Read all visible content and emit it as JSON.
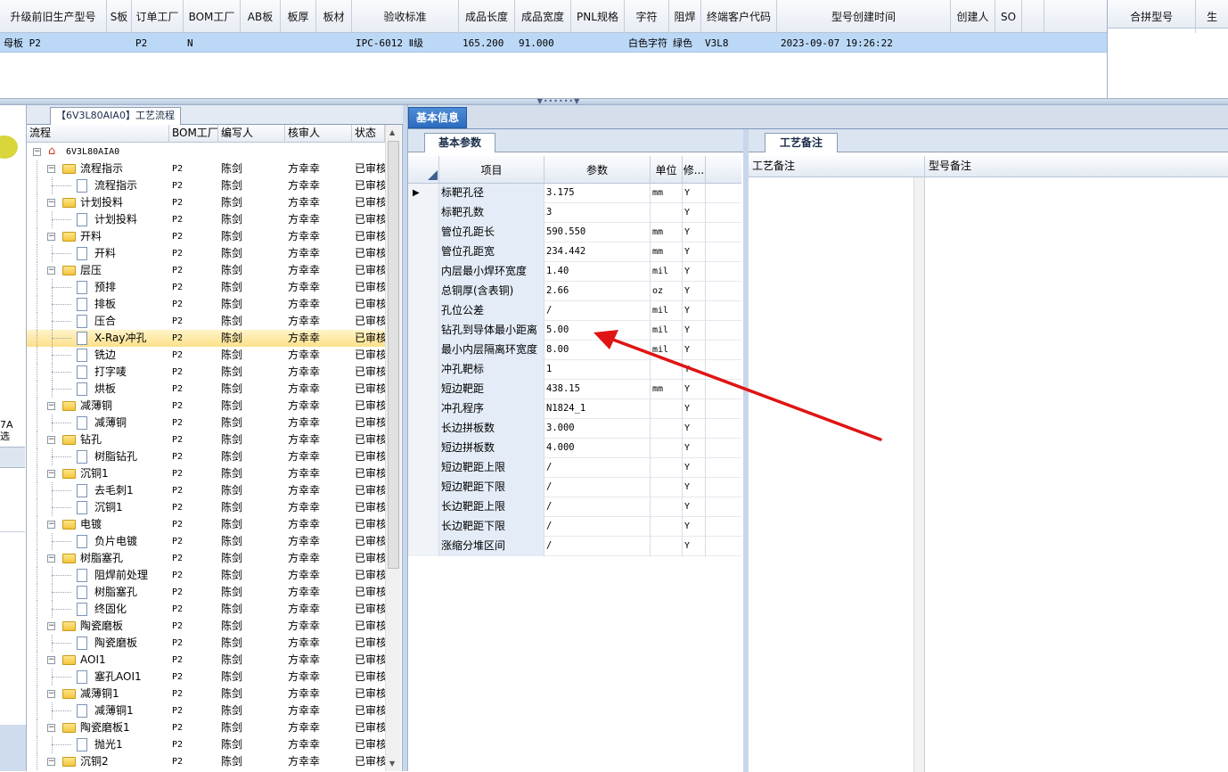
{
  "top_grid": {
    "columns": [
      {
        "label": "升级前旧生产型号",
        "w": 120
      },
      {
        "label": "S板",
        "w": 28
      },
      {
        "label": "订单工厂",
        "w": 58
      },
      {
        "label": "BOM工厂",
        "w": 64
      },
      {
        "label": "AB板",
        "w": 45
      },
      {
        "label": "板厚",
        "w": 40
      },
      {
        "label": "板材",
        "w": 40
      },
      {
        "label": "验收标准",
        "w": 120
      },
      {
        "label": "成品长度",
        "w": 63
      },
      {
        "label": "成品宽度",
        "w": 63
      },
      {
        "label": "PNL规格",
        "w": 60
      },
      {
        "label": "字符",
        "w": 50
      },
      {
        "label": "阻焊",
        "w": 36
      },
      {
        "label": "终端客户代码",
        "w": 85
      },
      {
        "label": "型号创建时间",
        "w": 195
      },
      {
        "label": "创建人",
        "w": 50
      },
      {
        "label": "SO",
        "w": 30
      },
      {
        "label": "",
        "w": 25
      }
    ],
    "row": [
      "母板  P2",
      "",
      "P2",
      "N",
      "",
      "",
      "",
      "IPC-6012 Ⅱ级",
      "165.200",
      "91.000",
      "",
      "白色字符",
      "绿色",
      "V3L8",
      "2023-09-07 19:26:22",
      "",
      "",
      ""
    ]
  },
  "merge_panel": {
    "col1": "合拼型号",
    "col2": "生"
  },
  "left_strip": {
    "label1": "7A",
    "label2": "选"
  },
  "process_panel": {
    "tab_title": "【6V3L80AIA0】工艺流程",
    "headers": [
      "流程",
      "BOM工厂",
      "编写人",
      "核审人",
      "状态"
    ],
    "root": "6V3L80AIA0",
    "rows": [
      {
        "lvl": 1,
        "name": "流程指示",
        "bom": "P2",
        "writer": "陈剑",
        "checker": "方幸幸",
        "status": "已审核"
      },
      {
        "lvl": 2,
        "name": "流程指示",
        "bom": "P2",
        "writer": "陈剑",
        "checker": "方幸幸",
        "status": "已审核"
      },
      {
        "lvl": 1,
        "name": "计划投料",
        "bom": "P2",
        "writer": "陈剑",
        "checker": "方幸幸",
        "status": "已审核"
      },
      {
        "lvl": 2,
        "name": "计划投料",
        "bom": "P2",
        "writer": "陈剑",
        "checker": "方幸幸",
        "status": "已审核"
      },
      {
        "lvl": 1,
        "name": "开料",
        "bom": "P2",
        "writer": "陈剑",
        "checker": "方幸幸",
        "status": "已审核"
      },
      {
        "lvl": 2,
        "name": "开料",
        "bom": "P2",
        "writer": "陈剑",
        "checker": "方幸幸",
        "status": "已审核"
      },
      {
        "lvl": 1,
        "name": "层压",
        "bom": "P2",
        "writer": "陈剑",
        "checker": "方幸幸",
        "status": "已审核"
      },
      {
        "lvl": 2,
        "name": "预排",
        "bom": "P2",
        "writer": "陈剑",
        "checker": "方幸幸",
        "status": "已审核"
      },
      {
        "lvl": 2,
        "name": "排板",
        "bom": "P2",
        "writer": "陈剑",
        "checker": "方幸幸",
        "status": "已审核"
      },
      {
        "lvl": 2,
        "name": "压合",
        "bom": "P2",
        "writer": "陈剑",
        "checker": "方幸幸",
        "status": "已审核"
      },
      {
        "lvl": 2,
        "name": "X-Ray冲孔",
        "bom": "P2",
        "writer": "陈剑",
        "checker": "方幸幸",
        "status": "已审核",
        "sel": true
      },
      {
        "lvl": 2,
        "name": "铣边",
        "bom": "P2",
        "writer": "陈剑",
        "checker": "方幸幸",
        "status": "已审核"
      },
      {
        "lvl": 2,
        "name": "打字唛",
        "bom": "P2",
        "writer": "陈剑",
        "checker": "方幸幸",
        "status": "已审核"
      },
      {
        "lvl": 2,
        "name": "烘板",
        "bom": "P2",
        "writer": "陈剑",
        "checker": "方幸幸",
        "status": "已审核"
      },
      {
        "lvl": 1,
        "name": "减薄铜",
        "bom": "P2",
        "writer": "陈剑",
        "checker": "方幸幸",
        "status": "已审核"
      },
      {
        "lvl": 2,
        "name": "减薄铜",
        "bom": "P2",
        "writer": "陈剑",
        "checker": "方幸幸",
        "status": "已审核"
      },
      {
        "lvl": 1,
        "name": "钻孔",
        "bom": "P2",
        "writer": "陈剑",
        "checker": "方幸幸",
        "status": "已审核"
      },
      {
        "lvl": 2,
        "name": "树脂钻孔",
        "bom": "P2",
        "writer": "陈剑",
        "checker": "方幸幸",
        "status": "已审核"
      },
      {
        "lvl": 1,
        "name": "沉铜1",
        "bom": "P2",
        "writer": "陈剑",
        "checker": "方幸幸",
        "status": "已审核"
      },
      {
        "lvl": 2,
        "name": "去毛刺1",
        "bom": "P2",
        "writer": "陈剑",
        "checker": "方幸幸",
        "status": "已审核"
      },
      {
        "lvl": 2,
        "name": "沉铜1",
        "bom": "P2",
        "writer": "陈剑",
        "checker": "方幸幸",
        "status": "已审核"
      },
      {
        "lvl": 1,
        "name": "电镀",
        "bom": "P2",
        "writer": "陈剑",
        "checker": "方幸幸",
        "status": "已审核"
      },
      {
        "lvl": 2,
        "name": "负片电镀",
        "bom": "P2",
        "writer": "陈剑",
        "checker": "方幸幸",
        "status": "已审核"
      },
      {
        "lvl": 1,
        "name": "树脂塞孔",
        "bom": "P2",
        "writer": "陈剑",
        "checker": "方幸幸",
        "status": "已审核"
      },
      {
        "lvl": 2,
        "name": "阻焊前处理",
        "bom": "P2",
        "writer": "陈剑",
        "checker": "方幸幸",
        "status": "已审核"
      },
      {
        "lvl": 2,
        "name": "树脂塞孔",
        "bom": "P2",
        "writer": "陈剑",
        "checker": "方幸幸",
        "status": "已审核"
      },
      {
        "lvl": 2,
        "name": "终固化",
        "bom": "P2",
        "writer": "陈剑",
        "checker": "方幸幸",
        "status": "已审核"
      },
      {
        "lvl": 1,
        "name": "陶瓷磨板",
        "bom": "P2",
        "writer": "陈剑",
        "checker": "方幸幸",
        "status": "已审核"
      },
      {
        "lvl": 2,
        "name": "陶瓷磨板",
        "bom": "P2",
        "writer": "陈剑",
        "checker": "方幸幸",
        "status": "已审核"
      },
      {
        "lvl": 1,
        "name": "AOI1",
        "bom": "P2",
        "writer": "陈剑",
        "checker": "方幸幸",
        "status": "已审核"
      },
      {
        "lvl": 2,
        "name": "塞孔AOI1",
        "bom": "P2",
        "writer": "陈剑",
        "checker": "方幸幸",
        "status": "已审核"
      },
      {
        "lvl": 1,
        "name": "减薄铜1",
        "bom": "P2",
        "writer": "陈剑",
        "checker": "方幸幸",
        "status": "已审核"
      },
      {
        "lvl": 2,
        "name": "减薄铜1",
        "bom": "P2",
        "writer": "陈剑",
        "checker": "方幸幸",
        "status": "已审核"
      },
      {
        "lvl": 1,
        "name": "陶瓷磨板1",
        "bom": "P2",
        "writer": "陈剑",
        "checker": "方幸幸",
        "status": "已审核"
      },
      {
        "lvl": 2,
        "name": "抛光1",
        "bom": "P2",
        "writer": "陈剑",
        "checker": "方幸幸",
        "status": "已审核"
      },
      {
        "lvl": 1,
        "name": "沉铜2",
        "bom": "P2",
        "writer": "陈剑",
        "checker": "方幸幸",
        "status": "已审核"
      }
    ]
  },
  "info_panel": {
    "tab": "基本信息",
    "basic_tab": "基本参数",
    "param_headers": {
      "item": "项目",
      "param": "参数",
      "unit": "单位",
      "mod": "修..."
    },
    "params": [
      {
        "name": "标靶孔径",
        "value": "3.175",
        "unit": "mm",
        "mod": "Y",
        "current": true
      },
      {
        "name": "标靶孔数",
        "value": "3",
        "unit": "",
        "mod": "Y"
      },
      {
        "name": "管位孔距长",
        "value": "590.550",
        "unit": "mm",
        "mod": "Y"
      },
      {
        "name": "管位孔距宽",
        "value": "234.442",
        "unit": "mm",
        "mod": "Y"
      },
      {
        "name": "内层最小焊环宽度",
        "value": "1.40",
        "unit": "mil",
        "mod": "Y"
      },
      {
        "name": "总铜厚(含表铜)",
        "value": "2.66",
        "unit": "oz",
        "mod": "Y"
      },
      {
        "name": "孔位公差",
        "value": "/",
        "unit": "mil",
        "mod": "Y"
      },
      {
        "name": "钻孔到导体最小距离",
        "value": "5.00",
        "unit": "mil",
        "mod": "Y"
      },
      {
        "name": "最小内层隔离环宽度",
        "value": "8.00",
        "unit": "mil",
        "mod": "Y"
      },
      {
        "name": "冲孔靶标",
        "value": "1",
        "unit": "",
        "mod": "Y"
      },
      {
        "name": "短边靶距",
        "value": "438.15",
        "unit": "mm",
        "mod": "Y"
      },
      {
        "name": "冲孔程序",
        "value": "N1824_1",
        "unit": "",
        "mod": "Y"
      },
      {
        "name": "长边拼板数",
        "value": "3.000",
        "unit": "",
        "mod": "Y"
      },
      {
        "name": "短边拼板数",
        "value": "4.000",
        "unit": "",
        "mod": "Y"
      },
      {
        "name": "短边靶距上限",
        "value": "/",
        "unit": "",
        "mod": "Y"
      },
      {
        "name": "短边靶距下限",
        "value": "/",
        "unit": "",
        "mod": "Y"
      },
      {
        "name": "长边靶距上限",
        "value": "/",
        "unit": "",
        "mod": "Y"
      },
      {
        "name": "长边靶距下限",
        "value": "/",
        "unit": "",
        "mod": "Y"
      },
      {
        "name": "涨缩分堆区间",
        "value": "/",
        "unit": "",
        "mod": "Y"
      }
    ],
    "notes_tab": "工艺备注",
    "notes_headers": [
      "工艺备注",
      "型号备注"
    ]
  },
  "colors": {
    "arrow": "#e01414",
    "selected_row": "#bcd8f7",
    "tab_active": "#2c6cc0"
  }
}
